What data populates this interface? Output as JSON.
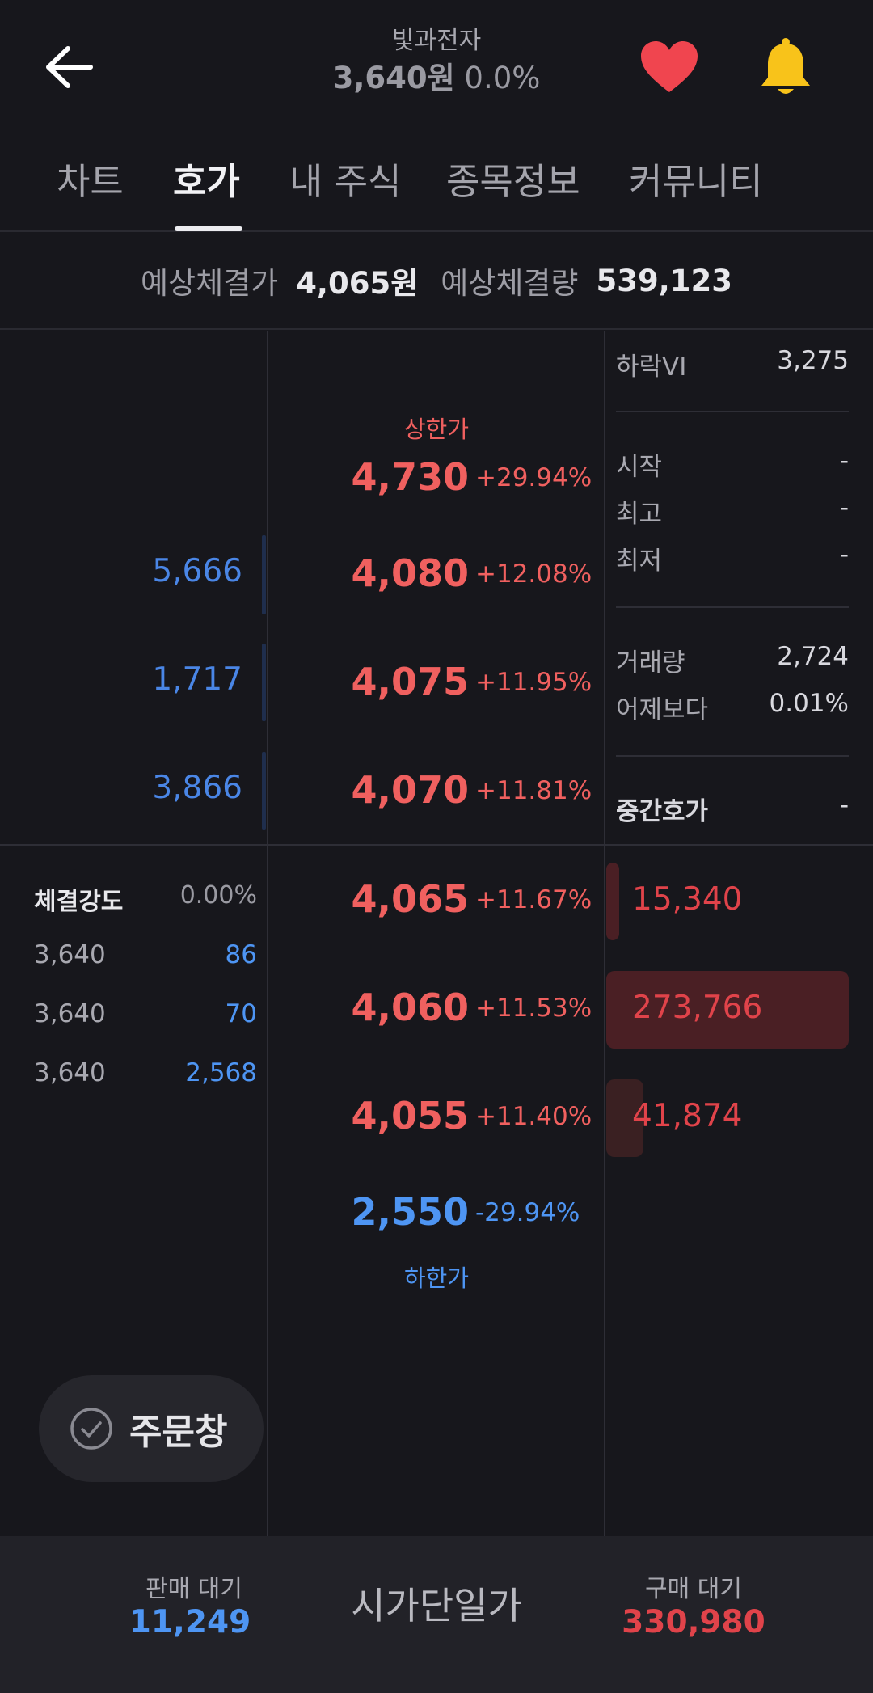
{
  "header": {
    "stock_name": "빛과전자",
    "price": "3,640원",
    "change": "0.0%"
  },
  "tabs": [
    {
      "label": "차트"
    },
    {
      "label": "호가"
    },
    {
      "label": "내 주식"
    },
    {
      "label": "종목정보"
    },
    {
      "label": "커뮤니티"
    }
  ],
  "active_tab": "호가",
  "expected": {
    "price_label": "예상체결가",
    "price_value": "4,065원",
    "volume_label": "예상체결량",
    "volume_value": "539,123"
  },
  "upper_limit": {
    "label": "상한가",
    "price": "4,730",
    "pct": "+29.94%"
  },
  "sell_rows": [
    {
      "qty": "5,666",
      "price": "4,080",
      "pct": "+12.08%"
    },
    {
      "qty": "1,717",
      "price": "4,075",
      "pct": "+11.95%"
    },
    {
      "qty": "3,866",
      "price": "4,070",
      "pct": "+11.81%"
    }
  ],
  "buy_rows": [
    {
      "price": "4,065",
      "pct": "+11.67%",
      "qty": "15,340"
    },
    {
      "price": "4,060",
      "pct": "+11.53%",
      "qty": "273,766"
    },
    {
      "price": "4,055",
      "pct": "+11.40%",
      "qty": "41,874"
    }
  ],
  "lower_limit": {
    "label": "하한가",
    "price": "2,550",
    "pct": "-29.94%"
  },
  "info": {
    "vi_label": "하락VI",
    "vi_value": "3,275",
    "open_label": "시작",
    "open_value": "-",
    "high_label": "최고",
    "high_value": "-",
    "low_label": "최저",
    "low_value": "-",
    "volume_label": "거래량",
    "volume_value": "2,724",
    "vs_yesterday_label": "어제보다",
    "vs_yesterday_value": "0.01%",
    "mid_label": "중간호가",
    "mid_value": "-"
  },
  "trades": {
    "strength_label": "체결강도",
    "strength_value": "0.00%",
    "rows": [
      {
        "price": "3,640",
        "qty": "86"
      },
      {
        "price": "3,640",
        "qty": "70"
      },
      {
        "price": "3,640",
        "qty": "2,568"
      }
    ]
  },
  "order_button": {
    "label": "주문창"
  },
  "bottom": {
    "sell_wait_label": "판매 대기",
    "sell_wait_value": "11,249",
    "center_label": "시가단일가",
    "buy_wait_label": "구매 대기",
    "buy_wait_value": "330,980"
  },
  "colors": {
    "up": "#f0605f",
    "down": "#4e95f3",
    "background": "#17171c",
    "heart": "#f0454f",
    "bell": "#f8c31a"
  },
  "icons": [
    "back-arrow-icon",
    "heart-icon",
    "bell-icon",
    "check-circle-icon"
  ]
}
